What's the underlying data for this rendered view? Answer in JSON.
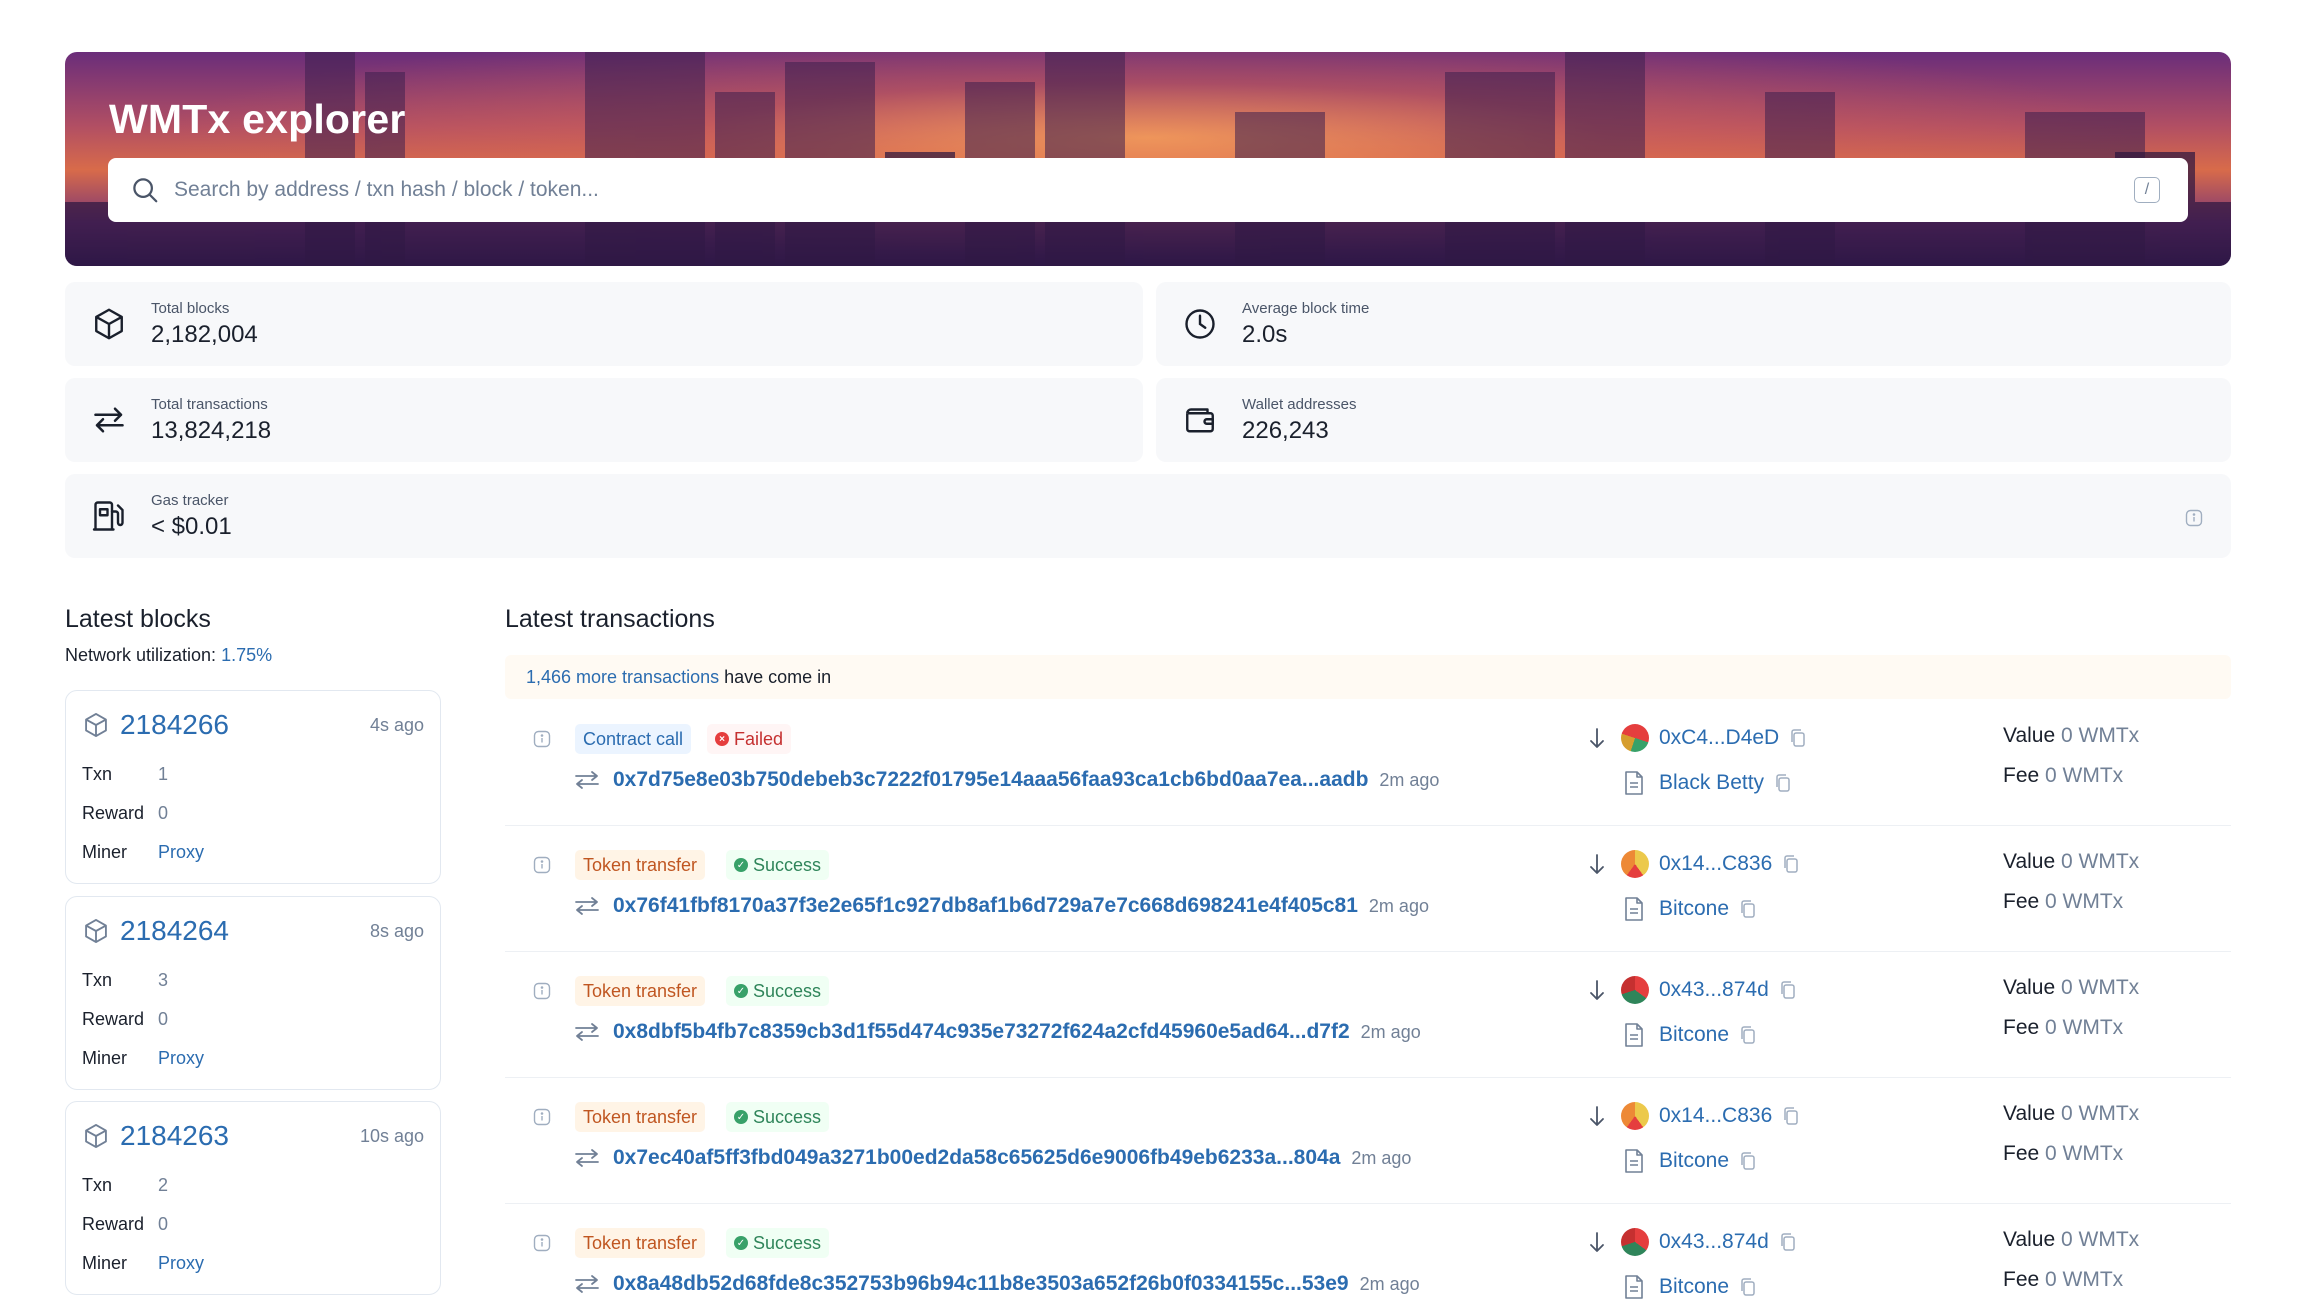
{
  "header": {
    "title": "WMTx explorer",
    "search_placeholder": "Search by address / txn hash / block / token...",
    "shortcut_key": "/"
  },
  "stats": {
    "total_blocks": {
      "label": "Total blocks",
      "value": "2,182,004",
      "icon": "cube-icon"
    },
    "avg_block_time": {
      "label": "Average block time",
      "value": "2.0s",
      "icon": "clock-icon"
    },
    "total_txns": {
      "label": "Total transactions",
      "value": "13,824,218",
      "icon": "swap-icon"
    },
    "wallets": {
      "label": "Wallet addresses",
      "value": "226,243",
      "icon": "wallet-icon"
    },
    "gas": {
      "label": "Gas tracker",
      "value": "< $0.01",
      "icon": "gas-pump-icon"
    }
  },
  "latest_blocks": {
    "title": "Latest blocks",
    "util_label": "Network utilization:",
    "util_value": "1.75%",
    "labels": {
      "txn": "Txn",
      "reward": "Reward",
      "miner": "Miner"
    },
    "items": [
      {
        "number": "2184266",
        "age": "4s ago",
        "txn": "1",
        "reward": "0",
        "miner": "Proxy"
      },
      {
        "number": "2184264",
        "age": "8s ago",
        "txn": "3",
        "reward": "0",
        "miner": "Proxy"
      },
      {
        "number": "2184263",
        "age": "10s ago",
        "txn": "2",
        "reward": "0",
        "miner": "Proxy"
      }
    ]
  },
  "latest_txns": {
    "title": "Latest transactions",
    "banner_count": "1,466 more transactions",
    "banner_suffix": "have come in",
    "labels": {
      "value": "Value",
      "fee": "Fee"
    },
    "items": [
      {
        "type": "Contract call",
        "status": "Failed",
        "hash": "0x7d75e8e03b750debeb3c7222f01795e14aaa56faa93ca1cb6bd0aa7ea...aadb",
        "age": "2m ago",
        "from": "0xC4...D4eD",
        "to": "Black Betty",
        "value": "0 WMTx",
        "fee": "0 WMTx"
      },
      {
        "type": "Token transfer",
        "status": "Success",
        "hash": "0x76f41fbf8170a37f3e2e65f1c927db8af1b6d729a7e7c668d698241e4f405c81",
        "age": "2m ago",
        "from": "0x14...C836",
        "to": "Bitcone",
        "value": "0 WMTx",
        "fee": "0 WMTx"
      },
      {
        "type": "Token transfer",
        "status": "Success",
        "hash": "0x8dbf5b4fb7c8359cb3d1f55d474c935e73272f624a2cfd45960e5ad64...d7f2",
        "age": "2m ago",
        "from": "0x43...874d",
        "to": "Bitcone",
        "value": "0 WMTx",
        "fee": "0 WMTx"
      },
      {
        "type": "Token transfer",
        "status": "Success",
        "hash": "0x7ec40af5ff3fbd049a3271b00ed2da58c65625d6e9006fb49eb6233a...804a",
        "age": "2m ago",
        "from": "0x14...C836",
        "to": "Bitcone",
        "value": "0 WMTx",
        "fee": "0 WMTx"
      },
      {
        "type": "Token transfer",
        "status": "Success",
        "hash": "0x8a48db52d68fde8c352753b96b94c11b8e3503a652f26b0f0334155c...53e9",
        "age": "2m ago",
        "from": "0x43...874d",
        "to": "Bitcone",
        "value": "0 WMTx",
        "fee": "0 WMTx"
      }
    ]
  },
  "colors": {
    "accent": "#2b6cb0",
    "success": "#38a169",
    "failed": "#e53e3e",
    "token_transfer": "#c05621"
  }
}
